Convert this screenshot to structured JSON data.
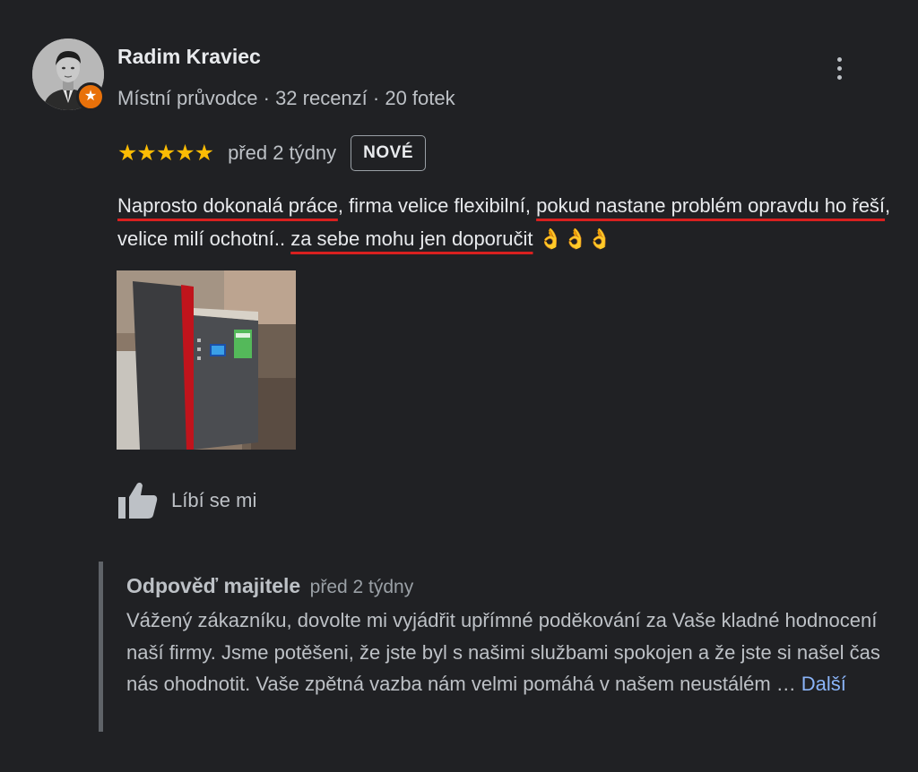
{
  "author": {
    "name": "Radim Kraviec",
    "meta": "Místní průvodce · 32 recenzí · 20 fotek"
  },
  "rating": {
    "stars": "★★★★★",
    "value": 5,
    "max": 5,
    "time": "před 2 týdny",
    "badge": "NOVÉ"
  },
  "review": {
    "segments": [
      {
        "text": "Naprosto dokonalá práce",
        "highlighted": true
      },
      {
        "text": ", firma velice flexibilní, ",
        "highlighted": false
      },
      {
        "text": "pokud nastane problém opravdu ho řeší",
        "highlighted": true
      },
      {
        "text": ", velice milí ochotní.. ",
        "highlighted": false
      },
      {
        "text": "za sebe mohu jen doporučit",
        "highlighted": true
      },
      {
        "text": " 👌👌👌",
        "highlighted": false
      }
    ]
  },
  "actions": {
    "like_label": "Líbí se mi"
  },
  "owner_reply": {
    "title": "Odpověď majitele",
    "time": "před 2 týdny",
    "text": "Vážený zákazníku, dovolte mi vyjádřit upřímné poděkování za Vaše kladné hodnocení naší firmy. Jsme potěšeni, že jste byl s našimi službami spokojen a že jste si našel čas nás ohodnotit. Vaše zpětná vazba nám velmi pomáhá v našem neustálém …",
    "more_label": "Další"
  },
  "colors": {
    "background": "#202124",
    "star": "#fbbc04",
    "highlight_underline": "#d9201f",
    "link": "#8ab4f8",
    "guide_badge": "#e8710a"
  },
  "icons": {
    "avatar": "user-portrait",
    "guide_badge": "star-icon",
    "more": "more-vert-icon",
    "like": "thumb-up-icon"
  }
}
